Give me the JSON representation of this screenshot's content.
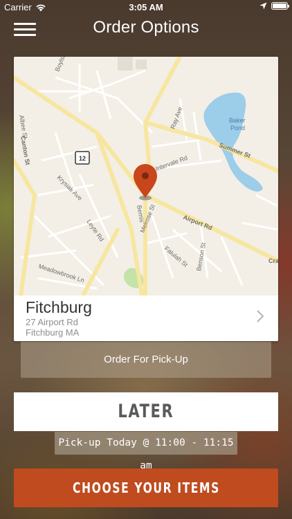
{
  "status_bar": {
    "carrier": "Carrier",
    "time": "3:05 AM"
  },
  "nav": {
    "title": "Order Options"
  },
  "map": {
    "street_labels": {
      "boylston": "Boylston St",
      "ray": "Ray Ave",
      "baker_pond": "Baker\nPond",
      "summer": "Summer St",
      "albee": "Albee St",
      "canton": "Canton St",
      "route": "12",
      "intervale": "Intervale Rd",
      "krysiak": "Krysiak Ave",
      "bemis": "Bemis",
      "melrose": "Melrose St",
      "airport": "Airport Rd",
      "leyte": "Leyte Rd",
      "falulah": "Falulah St",
      "benson": "Benson St",
      "meadowbrook": "Meadowbrook Ln",
      "cra": "Cra"
    }
  },
  "location": {
    "name": "Fitchburg",
    "address_line1": "27 Airport Rd",
    "address_line2": "Fitchburg MA"
  },
  "order_type": {
    "label": "Order For Pick-Up"
  },
  "time_option": {
    "label": "LATER",
    "pickup_time": "Pick-up Today @ 11:00 - 11:15 am"
  },
  "actions": {
    "choose_items": "CHOOSE YOUR ITEMS"
  },
  "colors": {
    "accent": "#bf4b1f",
    "map_pin": "#c9451b",
    "map_bg": "#f3efe6",
    "road_major": "#f7e6a0",
    "water": "#9ccde9",
    "park": "#c3e3a9"
  }
}
